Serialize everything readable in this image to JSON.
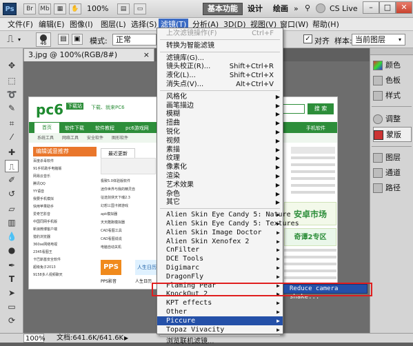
{
  "titlebar": {
    "logo": "Ps",
    "zoom": "100%",
    "workspaces": [
      "基本功能",
      "设计",
      "绘画"
    ],
    "cs_live": "CS Live",
    "win_min": "–",
    "win_max": "□",
    "win_close": "✕"
  },
  "menubar": [
    "文件(F)",
    "编辑(E)",
    "图像(I)",
    "图层(L)",
    "选择(S)",
    "滤镜(T)",
    "分析(A)",
    "3D(D)",
    "视图(V)",
    "窗口(W)",
    "帮助(H)"
  ],
  "optbar": {
    "brush_size": "46",
    "mode_label": "模式:",
    "mode_value": "正常",
    "align_label": "对齐",
    "sample_label": "样本:",
    "sample_value": "当前图层"
  },
  "document": {
    "tab_title": "3.jpg @ 100%(RGB/8#)",
    "tab_close": "×",
    "status_zoom": "100%",
    "status_doc": "文档:641.6K/641.6K"
  },
  "right_panel": [
    "颜色",
    "色板",
    "样式",
    "调整",
    "蒙版",
    "图层",
    "通道",
    "路径"
  ],
  "filter_menu": {
    "items": [
      {
        "label": "上次滤镜操作(F)",
        "shortcut": "Ctrl+F",
        "disabled": true
      },
      {
        "sep": true
      },
      {
        "label": "转换为智能滤镜"
      },
      {
        "sep": true
      },
      {
        "label": "滤镜库(G)..."
      },
      {
        "label": "镜头校正(R)...",
        "shortcut": "Shift+Ctrl+R"
      },
      {
        "label": "液化(L)...",
        "shortcut": "Shift+Ctrl+X"
      },
      {
        "label": "消失点(V)...",
        "shortcut": "Alt+Ctrl+V"
      },
      {
        "sep": true
      },
      {
        "label": "风格化",
        "sub": true
      },
      {
        "label": "画笔描边",
        "sub": true
      },
      {
        "label": "模糊",
        "sub": true
      },
      {
        "label": "扭曲",
        "sub": true
      },
      {
        "label": "锐化",
        "sub": true
      },
      {
        "label": "视频",
        "sub": true
      },
      {
        "label": "素描",
        "sub": true
      },
      {
        "label": "纹理",
        "sub": true
      },
      {
        "label": "像素化",
        "sub": true
      },
      {
        "label": "渲染",
        "sub": true
      },
      {
        "label": "艺术效果",
        "sub": true
      },
      {
        "label": "杂色",
        "sub": true
      },
      {
        "label": "其它",
        "sub": true
      },
      {
        "sep": true
      },
      {
        "label": "Alien Skin Eye Candy 5: Nature",
        "sub": true,
        "mono": true
      },
      {
        "label": "Alien Skin Eye Candy 5: Textures",
        "sub": true,
        "mono": true
      },
      {
        "label": "Alien Skin Image Doctor",
        "sub": true,
        "mono": true
      },
      {
        "label": "Alien Skin Xenofex 2",
        "sub": true,
        "mono": true
      },
      {
        "label": "CnFilter",
        "sub": true,
        "mono": true
      },
      {
        "label": "DCE Tools",
        "sub": true,
        "mono": true
      },
      {
        "label": "Digimarc",
        "sub": true,
        "mono": true
      },
      {
        "label": "DragonFly",
        "sub": true,
        "mono": true
      },
      {
        "label": "Flaming Pear",
        "sub": true,
        "mono": true
      },
      {
        "label": "KnockOut 2",
        "sub": true,
        "mono": true
      },
      {
        "label": "KPT effects",
        "sub": true,
        "mono": true
      },
      {
        "label": "Other",
        "sub": true,
        "mono": true
      },
      {
        "label": "Piccure",
        "sub": true,
        "mono": true,
        "highlight": true
      },
      {
        "label": "Topaz Vivacity",
        "sub": true,
        "mono": true
      },
      {
        "sep": true
      },
      {
        "label": "浏览联机滤镜..."
      }
    ],
    "submenu_item": "Reduce camera shake..."
  },
  "artwork": {
    "logo": "pc6",
    "logo_badge": "下载站",
    "tagline": "下载、就来PC6",
    "search_btn": "搜 索",
    "nav": [
      "首页",
      "软件下载",
      "软件教程",
      "pc6游戏网",
      "网游",
      "手机软件"
    ],
    "sub_nav": [
      "系统工具",
      "网络工具",
      "安全软件",
      "图形软件"
    ],
    "section_left": "编辑诚意推荐",
    "section_tab": "最近更新",
    "left_list": [
      "百度杀毒软件",
      "91手机助手电脑版",
      "网易云音乐",
      "腾讯QQ",
      "YY语音",
      "我要手机模拟",
      "快用苹果助手",
      "爱奇艺影音",
      "中国同网手机版",
      "新浪微博客户端",
      "猎豹浏览器",
      "360se网络电视",
      "2345看图王",
      "卡巴斯基安全软件",
      "超级兔子2013",
      "9158多人视频聊天"
    ],
    "mid_list": [
      "极致5.0体验版软件",
      "迷你世界与我的精灵自",
      "征途剑侠天下魂2.3",
      "幻想三国卡牌游戏",
      "apk模拟器",
      "天天酷跑模拟器",
      "CAD看图工具",
      "CAD看图说说",
      "电脑自动关机"
    ],
    "right_badge": "安卓市场",
    "right_badge2": "奇谭2专区",
    "mini_logo1": "PPS",
    "mini_logo2": "人生日历",
    "mini_cap1": "PPS影音",
    "mini_cap2": "人生日历"
  }
}
